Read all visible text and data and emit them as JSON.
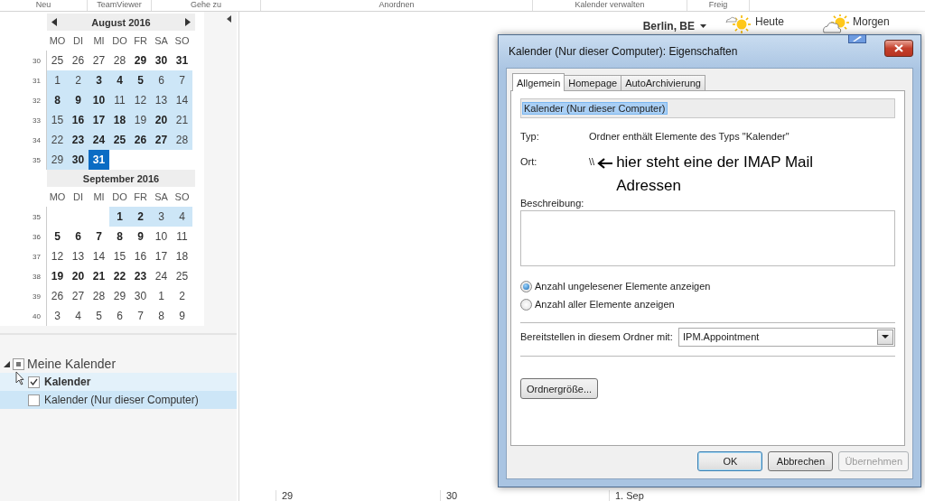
{
  "ribbon_groups": [
    "Neu",
    "TeamViewer",
    "Gehe zu",
    "Anordnen",
    "Kalender verwalten",
    "Freig"
  ],
  "date_navigator": {
    "months": [
      {
        "title": "August 2016",
        "has_prev": true,
        "has_next": true,
        "weekdays": [
          "MO",
          "DI",
          "MI",
          "DO",
          "FR",
          "SA",
          "SO"
        ],
        "weeks": [
          {
            "number": "30",
            "days": [
              {
                "text": "25",
                "bold": false,
                "shaded": false,
                "selected": false
              },
              {
                "text": "26",
                "bold": false,
                "shaded": false,
                "selected": false
              },
              {
                "text": "27",
                "bold": false,
                "shaded": false,
                "selected": false
              },
              {
                "text": "28",
                "bold": false,
                "shaded": false,
                "selected": false
              },
              {
                "text": "29",
                "bold": true,
                "shaded": false,
                "selected": false
              },
              {
                "text": "30",
                "bold": true,
                "shaded": false,
                "selected": false
              },
              {
                "text": "31",
                "bold": true,
                "shaded": false,
                "selected": false
              }
            ]
          },
          {
            "number": "31",
            "days": [
              {
                "text": "1",
                "bold": false,
                "shaded": true,
                "selected": false
              },
              {
                "text": "2",
                "bold": false,
                "shaded": true,
                "selected": false
              },
              {
                "text": "3",
                "bold": true,
                "shaded": true,
                "selected": false
              },
              {
                "text": "4",
                "bold": true,
                "shaded": true,
                "selected": false
              },
              {
                "text": "5",
                "bold": true,
                "shaded": true,
                "selected": false
              },
              {
                "text": "6",
                "bold": false,
                "shaded": true,
                "selected": false
              },
              {
                "text": "7",
                "bold": false,
                "shaded": true,
                "selected": false
              }
            ]
          },
          {
            "number": "32",
            "days": [
              {
                "text": "8",
                "bold": true,
                "shaded": true,
                "selected": false
              },
              {
                "text": "9",
                "bold": true,
                "shaded": true,
                "selected": false
              },
              {
                "text": "10",
                "bold": true,
                "shaded": true,
                "selected": false
              },
              {
                "text": "11",
                "bold": false,
                "shaded": true,
                "selected": false
              },
              {
                "text": "12",
                "bold": false,
                "shaded": true,
                "selected": false
              },
              {
                "text": "13",
                "bold": false,
                "shaded": true,
                "selected": false
              },
              {
                "text": "14",
                "bold": false,
                "shaded": true,
                "selected": false
              }
            ]
          },
          {
            "number": "33",
            "days": [
              {
                "text": "15",
                "bold": false,
                "shaded": true,
                "selected": false
              },
              {
                "text": "16",
                "bold": true,
                "shaded": true,
                "selected": false
              },
              {
                "text": "17",
                "bold": true,
                "shaded": true,
                "selected": false
              },
              {
                "text": "18",
                "bold": true,
                "shaded": true,
                "selected": false
              },
              {
                "text": "19",
                "bold": false,
                "shaded": true,
                "selected": false
              },
              {
                "text": "20",
                "bold": true,
                "shaded": true,
                "selected": false
              },
              {
                "text": "21",
                "bold": false,
                "shaded": true,
                "selected": false
              }
            ]
          },
          {
            "number": "34",
            "days": [
              {
                "text": "22",
                "bold": false,
                "shaded": true,
                "selected": false
              },
              {
                "text": "23",
                "bold": true,
                "shaded": true,
                "selected": false
              },
              {
                "text": "24",
                "bold": true,
                "shaded": true,
                "selected": false
              },
              {
                "text": "25",
                "bold": true,
                "shaded": true,
                "selected": false
              },
              {
                "text": "26",
                "bold": true,
                "shaded": true,
                "selected": false
              },
              {
                "text": "27",
                "bold": true,
                "shaded": true,
                "selected": false
              },
              {
                "text": "28",
                "bold": false,
                "shaded": true,
                "selected": false
              }
            ]
          },
          {
            "number": "35",
            "days": [
              {
                "text": "29",
                "bold": false,
                "shaded": true,
                "selected": false
              },
              {
                "text": "30",
                "bold": true,
                "shaded": true,
                "selected": false
              },
              {
                "text": "31",
                "bold": true,
                "shaded": true,
                "selected": true
              }
            ]
          }
        ]
      },
      {
        "title": "September 2016",
        "has_prev": false,
        "has_next": false,
        "weekdays": [
          "MO",
          "DI",
          "MI",
          "DO",
          "FR",
          "SA",
          "SO"
        ],
        "weeks": [
          {
            "number": "35",
            "days": [
              {
                "kind": "blank"
              },
              {
                "kind": "blank"
              },
              {
                "kind": "blank"
              },
              {
                "text": "1",
                "bold": true,
                "shaded": true,
                "selected": false
              },
              {
                "text": "2",
                "bold": true,
                "shaded": true,
                "selected": false
              },
              {
                "text": "3",
                "bold": false,
                "shaded": true,
                "selected": false
              },
              {
                "text": "4",
                "bold": false,
                "shaded": true,
                "selected": false
              }
            ]
          },
          {
            "number": "36",
            "days": [
              {
                "text": "5",
                "bold": true,
                "shaded": false,
                "selected": false
              },
              {
                "text": "6",
                "bold": true,
                "shaded": false,
                "selected": false
              },
              {
                "text": "7",
                "bold": true,
                "shaded": false,
                "selected": false
              },
              {
                "text": "8",
                "bold": true,
                "shaded": false,
                "selected": false
              },
              {
                "text": "9",
                "bold": true,
                "shaded": false,
                "selected": false
              },
              {
                "text": "10",
                "bold": false,
                "shaded": false,
                "selected": false
              },
              {
                "text": "11",
                "bold": false,
                "shaded": false,
                "selected": false
              }
            ]
          },
          {
            "number": "37",
            "days": [
              {
                "text": "12",
                "bold": false,
                "shaded": false,
                "selected": false
              },
              {
                "text": "13",
                "bold": false,
                "shaded": false,
                "selected": false
              },
              {
                "text": "14",
                "bold": false,
                "shaded": false,
                "selected": false
              },
              {
                "text": "15",
                "bold": false,
                "shaded": false,
                "selected": false
              },
              {
                "text": "16",
                "bold": false,
                "shaded": false,
                "selected": false
              },
              {
                "text": "17",
                "bold": false,
                "shaded": false,
                "selected": false
              },
              {
                "text": "18",
                "bold": false,
                "shaded": false,
                "selected": false
              }
            ]
          },
          {
            "number": "38",
            "days": [
              {
                "text": "19",
                "bold": true,
                "shaded": false,
                "selected": false
              },
              {
                "text": "20",
                "bold": true,
                "shaded": false,
                "selected": false
              },
              {
                "text": "21",
                "bold": true,
                "shaded": false,
                "selected": false
              },
              {
                "text": "22",
                "bold": true,
                "shaded": false,
                "selected": false
              },
              {
                "text": "23",
                "bold": true,
                "shaded": false,
                "selected": false
              },
              {
                "text": "24",
                "bold": false,
                "shaded": false,
                "selected": false
              },
              {
                "text": "25",
                "bold": false,
                "shaded": false,
                "selected": false
              }
            ]
          },
          {
            "number": "39",
            "days": [
              {
                "text": "26",
                "bold": false,
                "shaded": false,
                "selected": false
              },
              {
                "text": "27",
                "bold": false,
                "shaded": false,
                "selected": false
              },
              {
                "text": "28",
                "bold": false,
                "shaded": false,
                "selected": false
              },
              {
                "text": "29",
                "bold": false,
                "shaded": false,
                "selected": false
              },
              {
                "text": "30",
                "bold": false,
                "shaded": false,
                "selected": false
              },
              {
                "text": "1",
                "bold": false,
                "shaded": false,
                "selected": false
              },
              {
                "text": "2",
                "bold": false,
                "shaded": false,
                "selected": false
              }
            ]
          },
          {
            "number": "40",
            "days": [
              {
                "text": "3",
                "bold": false,
                "shaded": false,
                "selected": false
              },
              {
                "text": "4",
                "bold": false,
                "shaded": false,
                "selected": false
              },
              {
                "text": "5",
                "bold": false,
                "shaded": false,
                "selected": false
              },
              {
                "text": "6",
                "bold": false,
                "shaded": false,
                "selected": false
              },
              {
                "text": "7",
                "bold": false,
                "shaded": false,
                "selected": false
              },
              {
                "text": "8",
                "bold": false,
                "shaded": false,
                "selected": false
              },
              {
                "text": "9",
                "bold": false,
                "shaded": false,
                "selected": false
              }
            ]
          }
        ]
      }
    ]
  },
  "folders": {
    "group": {
      "label": "Meine Kalender",
      "expanded": true,
      "partial": true
    },
    "items": [
      {
        "label": "Kalender",
        "checked": true,
        "hovered": true,
        "selected": false
      },
      {
        "label": "Kalender (Nur dieser Computer)",
        "checked": false,
        "hovered": false,
        "selected": true
      }
    ]
  },
  "weather": {
    "location": "Berlin, BE",
    "days": [
      {
        "label": "Heute",
        "kind": "sun-cloud"
      },
      {
        "label": "Morgen",
        "kind": "cloud-sun"
      }
    ]
  },
  "calendar_dates": [
    "29",
    "30",
    "1. Sep"
  ],
  "dialog": {
    "title": "Kalender (Nur dieser Computer): Eigenschaften",
    "tabs": [
      {
        "label": "Allgemein",
        "selected": true
      },
      {
        "label": "Homepage",
        "selected": false
      },
      {
        "label": "AutoArchivierung",
        "selected": false
      }
    ],
    "name_value": "Kalender (Nur dieser Computer)",
    "fields": [
      {
        "label": "Typ:",
        "value": "Ordner enthält Elemente des Typs \"Kalender\""
      },
      {
        "label": "Ort:",
        "value": "\\\\"
      }
    ],
    "annotation": "hier steht eine der IMAP Mail Adressen",
    "description_label": "Beschreibung:",
    "radios": [
      {
        "label": "Anzahl ungelesener Elemente anzeigen",
        "selected": true
      },
      {
        "label": "Anzahl aller Elemente anzeigen",
        "selected": false
      }
    ],
    "post_label": "Bereitstellen in diesem Ordner mit:",
    "post_value": "IPM.Appointment",
    "size_button": "Ordnergröße...",
    "buttons": [
      {
        "label": "OK",
        "default": true,
        "disabled": false
      },
      {
        "label": "Abbrechen",
        "default": false,
        "disabled": false
      },
      {
        "label": "Übernehmen",
        "default": false,
        "disabled": true
      }
    ]
  }
}
